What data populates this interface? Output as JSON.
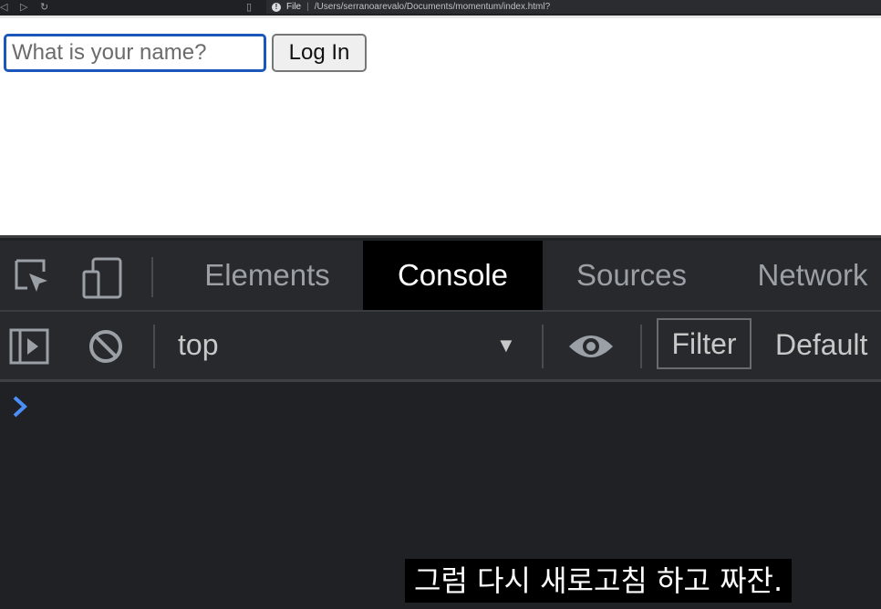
{
  "browser": {
    "address_prefix": "File",
    "url": "/Users/serranoarevalo/Documents/momentum/index.html?"
  },
  "page": {
    "name_input_placeholder": "What is your name?",
    "login_button_label": "Log In"
  },
  "devtools": {
    "tabs": [
      {
        "label": "Elements",
        "active": false
      },
      {
        "label": "Console",
        "active": true
      },
      {
        "label": "Sources",
        "active": false
      },
      {
        "label": "Network",
        "active": false
      }
    ],
    "context_label": "top",
    "filter_label": "Filter",
    "levels_label": "Default",
    "accent_color": "#4c8ef7"
  },
  "subtitle": "그럼 다시 새로고침 하고 짜잔."
}
